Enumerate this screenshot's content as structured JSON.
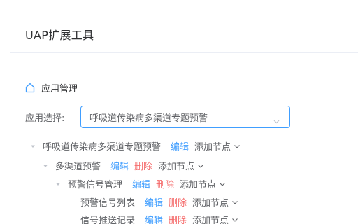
{
  "app": {
    "title": "UAP扩展工具"
  },
  "section": {
    "title": "应用管理",
    "icon": "home-icon"
  },
  "selector": {
    "label": "应用选择:",
    "value": "呼吸道传染病多渠道专题预警"
  },
  "tree": [
    {
      "label": "呼吸道传染病多渠道专题预警",
      "edit": "编辑",
      "add": "添加节点",
      "expanded": true
    },
    {
      "label": "多渠道预警",
      "edit": "编辑",
      "delete": "删除",
      "add": "添加节点",
      "expanded": true
    },
    {
      "label": "预警信号管理",
      "edit": "编辑",
      "delete": "删除",
      "add": "添加节点",
      "expanded": true
    },
    {
      "label": "预警信号列表",
      "edit": "编辑",
      "delete": "删除",
      "add": "添加节点"
    },
    {
      "label": "信号推送记录",
      "edit": "编辑",
      "delete": "删除",
      "add": "添加节点"
    }
  ],
  "colors": {
    "accent": "#409eff",
    "danger": "#f56c6c",
    "text": "#606266"
  }
}
